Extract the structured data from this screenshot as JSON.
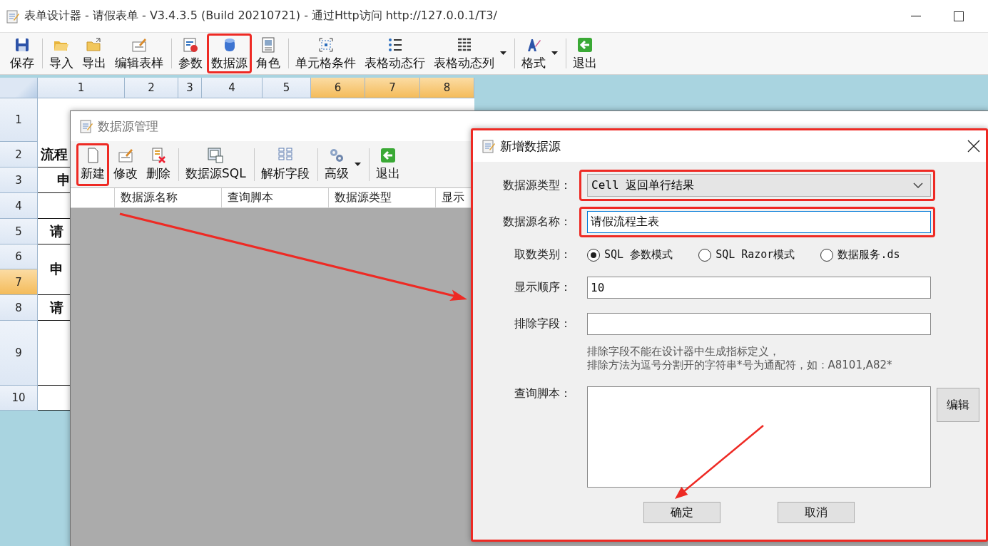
{
  "window": {
    "title": "表单设计器 - 请假表单 - V3.4.3.5 (Build 20210721) - 通过Http访问 http://127.0.0.1/T3/"
  },
  "toolbar": [
    {
      "label": "保存",
      "separator_before": false,
      "dropdown": false,
      "highlighted": false
    },
    {
      "label": "导入",
      "separator_before": true,
      "dropdown": false,
      "highlighted": false
    },
    {
      "label": "导出",
      "separator_before": false,
      "dropdown": false,
      "highlighted": false
    },
    {
      "label": "编辑表样",
      "separator_before": false,
      "dropdown": false,
      "highlighted": false
    },
    {
      "label": "参数",
      "separator_before": true,
      "dropdown": false,
      "highlighted": false
    },
    {
      "label": "数据源",
      "separator_before": false,
      "dropdown": false,
      "highlighted": true
    },
    {
      "label": "角色",
      "separator_before": false,
      "dropdown": false,
      "highlighted": false
    },
    {
      "label": "单元格条件",
      "separator_before": true,
      "dropdown": false,
      "highlighted": false
    },
    {
      "label": "表格动态行",
      "separator_before": false,
      "dropdown": false,
      "highlighted": false
    },
    {
      "label": "表格动态列",
      "separator_before": false,
      "dropdown": true,
      "highlighted": false
    },
    {
      "label": "格式",
      "separator_before": true,
      "dropdown": true,
      "highlighted": false
    },
    {
      "label": "退出",
      "separator_before": true,
      "dropdown": false,
      "highlighted": false
    }
  ],
  "sheet": {
    "columns": [
      {
        "label": "1",
        "selected": false
      },
      {
        "label": "2",
        "selected": false
      },
      {
        "label": "3",
        "selected": false
      },
      {
        "label": "4",
        "selected": false
      },
      {
        "label": "5",
        "selected": false
      },
      {
        "label": "6",
        "selected": true
      },
      {
        "label": "7",
        "selected": true
      },
      {
        "label": "8",
        "selected": true
      }
    ],
    "rows": [
      {
        "label": "1",
        "selected": false
      },
      {
        "label": "2",
        "selected": false,
        "text": "流程"
      },
      {
        "label": "3",
        "selected": false,
        "text": "申"
      },
      {
        "label": "4",
        "selected": false
      },
      {
        "label": "5",
        "selected": false,
        "text": "请"
      },
      {
        "label": "6",
        "selected": false,
        "text": "申"
      },
      {
        "label": "7",
        "selected": true
      },
      {
        "label": "8",
        "selected": false,
        "text": "请"
      },
      {
        "label": "9",
        "selected": false
      },
      {
        "label": "10",
        "selected": false
      }
    ]
  },
  "datasource_manager": {
    "title": "数据源管理",
    "toolbar": [
      {
        "label": "新建",
        "separator_before": false,
        "dropdown": false,
        "highlighted": true
      },
      {
        "label": "修改",
        "separator_before": false,
        "dropdown": false,
        "highlighted": false
      },
      {
        "label": "删除",
        "separator_before": false,
        "dropdown": false,
        "highlighted": false
      },
      {
        "label": "数据源SQL",
        "separator_before": true,
        "dropdown": false,
        "highlighted": false
      },
      {
        "label": "解析字段",
        "separator_before": true,
        "dropdown": false,
        "highlighted": false
      },
      {
        "label": "高级",
        "separator_before": true,
        "dropdown": true,
        "highlighted": false
      },
      {
        "label": "退出",
        "separator_before": true,
        "dropdown": false,
        "highlighted": false
      }
    ],
    "columns": [
      "数据源名称",
      "查询脚本",
      "数据源类型",
      "显示"
    ]
  },
  "dialog": {
    "title": "新增数据源",
    "highlighted": true,
    "fields": [
      {
        "kind": "select",
        "label": "数据源类型：",
        "value": "Cell 返回单行结果",
        "highlighted": true
      },
      {
        "kind": "input",
        "label": "数据源名称：",
        "value": "请假流程主表",
        "highlighted": true
      },
      {
        "kind": "radio",
        "label": "取数类别：",
        "options": [
          {
            "label": "SQL 参数模式",
            "selected": true
          },
          {
            "label": "SQL Razor模式",
            "selected": false
          },
          {
            "label": "数据服务.ds",
            "selected": false
          }
        ]
      },
      {
        "kind": "input",
        "label": "显示顺序：",
        "value": "10",
        "highlighted": false
      },
      {
        "kind": "input",
        "label": "排除字段：",
        "highlighted": false
      },
      {
        "kind": "note",
        "lines": [
          "排除字段不能在设计器中生成指标定义，",
          "排除方法为逗号分割开的字符串*号为通配符，如：A8101,A82*"
        ]
      },
      {
        "kind": "textarea",
        "label": "查询脚本：",
        "button": "编辑"
      }
    ],
    "buttons": [
      "确定",
      "取消"
    ]
  }
}
